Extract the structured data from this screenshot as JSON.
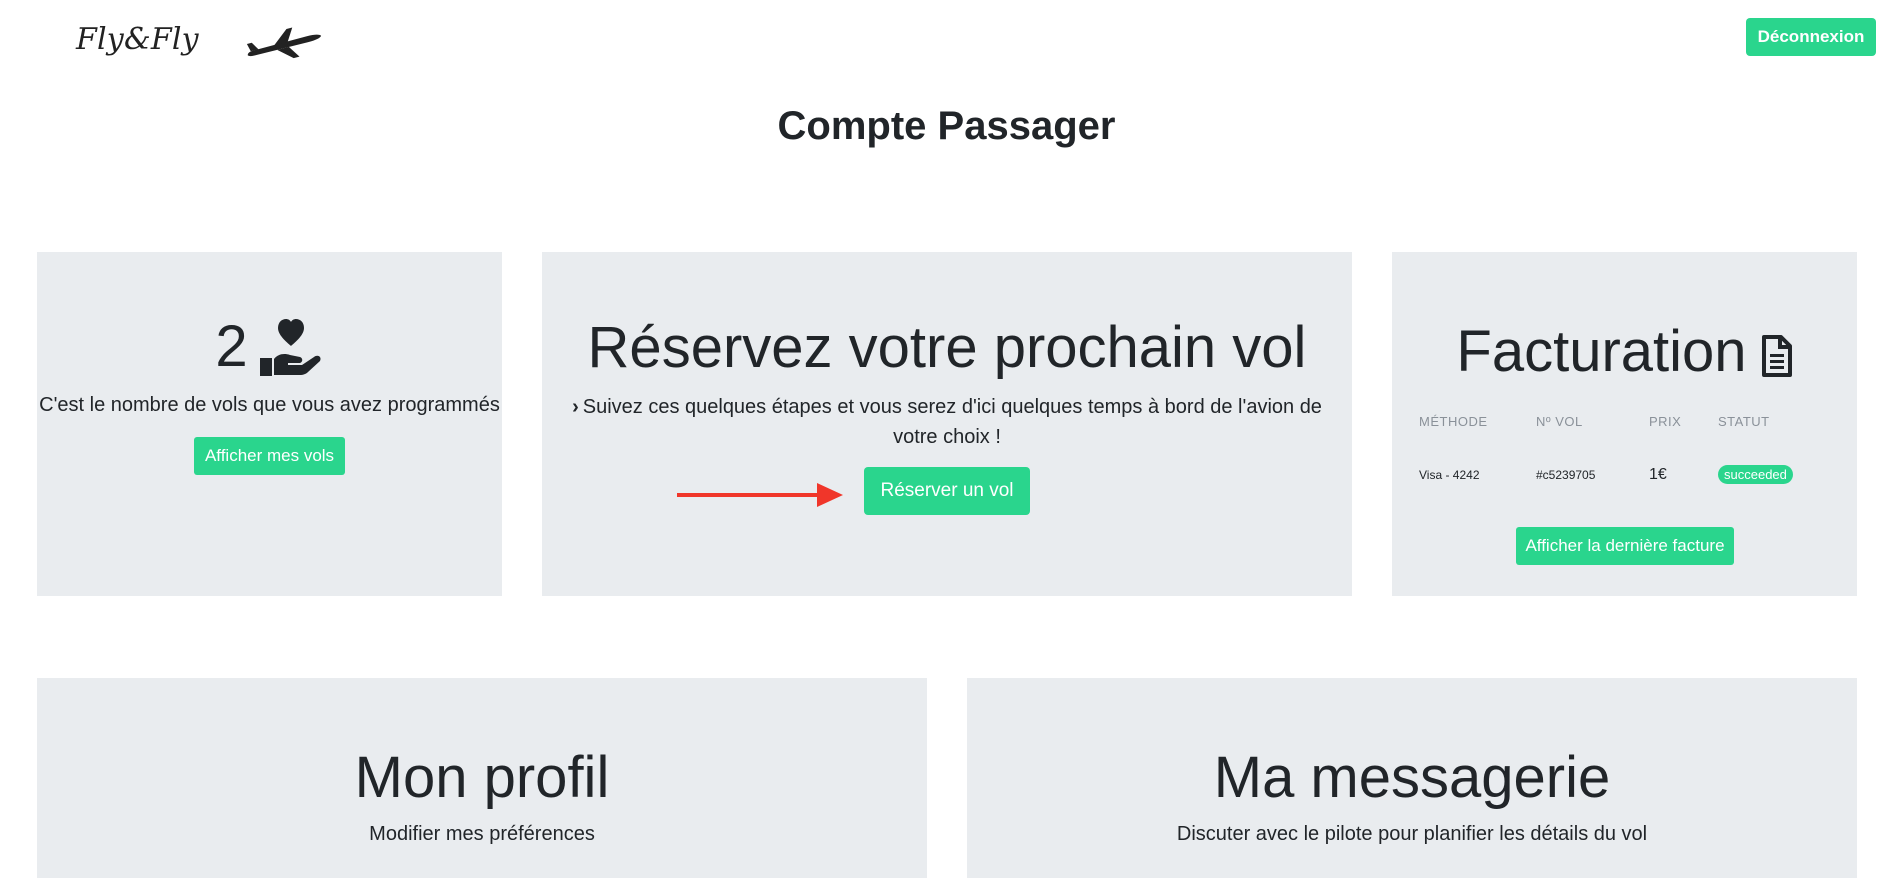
{
  "header": {
    "brand": "Fly&Fly",
    "logout_label": "Déconnexion"
  },
  "page": {
    "title": "Compte Passager"
  },
  "stats_card": {
    "count": "2",
    "text": "C'est le nombre de vols que vous avez programmés",
    "button_label": "Afficher mes vols"
  },
  "booking_card": {
    "title": "Réservez votre prochain vol",
    "text": "Suivez ces quelques étapes et vous serez d'ici quelques temps à bord de l'avion de votre choix !",
    "button_label": "Réserver un vol"
  },
  "billing_card": {
    "title": "Facturation",
    "columns": [
      "MÉTHODE",
      "Nº VOL",
      "PRIX",
      "STATUT"
    ],
    "row": {
      "method": "Visa - 4242",
      "flight_no": "#c5239705",
      "price": "1€",
      "status": "succeeded"
    },
    "button_label": "Afficher la dernière facture"
  },
  "profile_card": {
    "title": "Mon profil",
    "text": "Modifier mes préférences"
  },
  "messages_card": {
    "title": "Ma messagerie",
    "text": "Discuter avec le pilote pour planifier les détails du vol"
  },
  "colors": {
    "accent": "#2ad58d",
    "card_bg": "#e9ecef",
    "annotation_arrow": "#f0362a"
  },
  "icons": {
    "plane": "airplane-icon",
    "stats": "hand-holding-heart-icon",
    "billing": "file-text-icon",
    "chevron": "chevron-right-icon"
  }
}
